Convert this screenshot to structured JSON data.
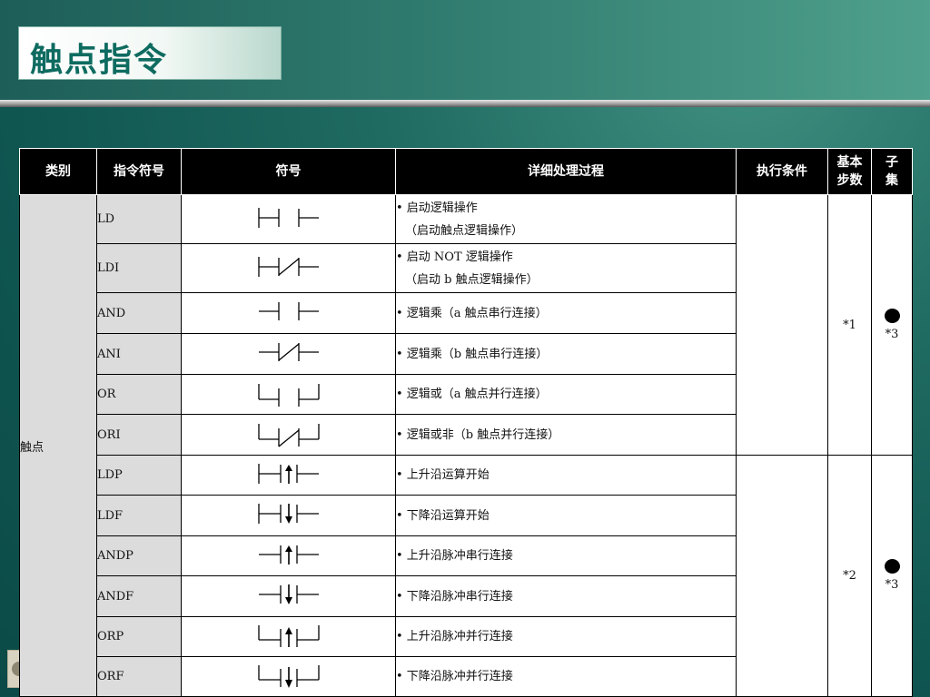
{
  "title": "触点指令",
  "table": {
    "headers": [
      "类别",
      "指令符号",
      "符号",
      "详细处理过程",
      "执行条件",
      "基本\n步数",
      "子\n集"
    ],
    "category": "触点",
    "rows": [
      {
        "code": "LD",
        "symbol": "nc-contact-start",
        "desc1": "• 启动逻辑操作",
        "desc2": "（启动触点逻辑操作）"
      },
      {
        "code": "LDI",
        "symbol": "nc-contact-start-not",
        "desc1": "• 启动 NOT 逻辑操作",
        "desc2": "（启动 b 触点逻辑操作）"
      },
      {
        "code": "AND",
        "symbol": "series-contact",
        "desc1": "• 逻辑乘（a 触点串行连接）",
        "desc2": ""
      },
      {
        "code": "ANI",
        "symbol": "series-contact-not",
        "desc1": "• 逻辑乘（b 触点串行连接）",
        "desc2": ""
      },
      {
        "code": "OR",
        "symbol": "parallel-contact",
        "desc1": "• 逻辑或（a 触点并行连接）",
        "desc2": ""
      },
      {
        "code": "ORI",
        "symbol": "parallel-contact-not",
        "desc1": "• 逻辑或非（b 触点并行连接）",
        "desc2": ""
      },
      {
        "code": "LDP",
        "symbol": "rising-start",
        "desc1": "• 上升沿运算开始",
        "desc2": ""
      },
      {
        "code": "LDF",
        "symbol": "falling-start",
        "desc1": "• 下降沿运算开始",
        "desc2": ""
      },
      {
        "code": "ANDP",
        "symbol": "rising-series",
        "desc1": "• 上升沿脉冲串行连接",
        "desc2": ""
      },
      {
        "code": "ANDF",
        "symbol": "falling-series",
        "desc1": "• 下降沿脉冲串行连接",
        "desc2": ""
      },
      {
        "code": "ORP",
        "symbol": "rising-parallel",
        "desc1": "• 上升沿脉冲并行连接",
        "desc2": ""
      },
      {
        "code": "ORF",
        "symbol": "falling-parallel",
        "desc1": "• 下降沿脉冲并行连接",
        "desc2": ""
      }
    ],
    "group1": {
      "steps": "*1",
      "sub_note": "*3"
    },
    "group2": {
      "steps": "*2",
      "sub_note": "*3"
    }
  }
}
